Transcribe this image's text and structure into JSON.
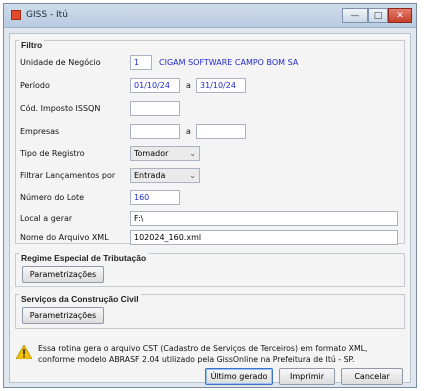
{
  "window": {
    "title": "GISS - Itú",
    "minimize_glyph": "—",
    "maximize_glyph": "□",
    "close_glyph": "✕"
  },
  "filtro": {
    "title": "Filtro",
    "unidade_label": "Unidade de Negócio",
    "unidade_code": "1",
    "unidade_name": "CIGAM SOFTWARE CAMPO BOM SA",
    "periodo_label": "Período",
    "periodo_from": "01/10/24",
    "periodo_sep": "a",
    "periodo_to": "31/10/24",
    "imposto_label": "Cód. Imposto ISSQN",
    "imposto_value": "",
    "empresas_label": "Empresas",
    "empresas_from": "",
    "empresas_sep": "a",
    "empresas_to": "",
    "tipo_label": "Tipo de Registro",
    "tipo_value": "Tomador",
    "filtrar_label": "Filtrar Lançamentos por",
    "filtrar_value": "Entrada",
    "lote_label": "Número do Lote",
    "lote_value": "160",
    "local_label": "Local a gerar",
    "local_value": "F:\\",
    "arquivo_label": "Nome do Arquivo XML",
    "arquivo_value": "102024_160.xml"
  },
  "regime": {
    "title": "Regime Especial de Tributação",
    "button": "Parametrizações"
  },
  "construcao": {
    "title": "Serviços da Construção Civil",
    "button": "Parametrizações"
  },
  "message": "Essa rotina gera o arquivo CST (Cadastro de Serviços de Terceiros) em formato XML, conforme modelo ABRASF 2.04 utilizado pela GissOnline na Prefeitura de Itú - SP.",
  "footer": {
    "ultimo": "Último gerado",
    "imprimir": "Imprimir",
    "cancelar": "Cancelar"
  },
  "colors": {
    "value_text": "#1f2bd0",
    "warning": "#f2c200"
  }
}
